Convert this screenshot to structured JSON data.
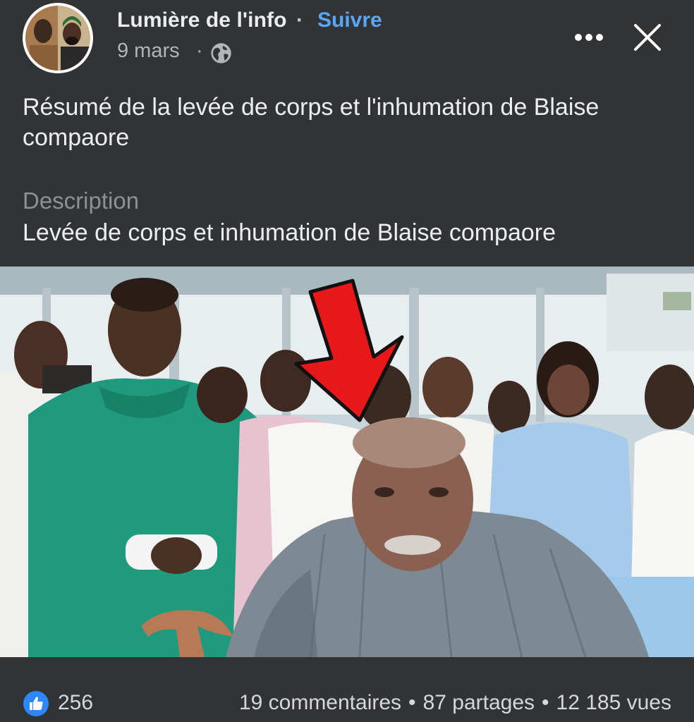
{
  "header": {
    "page_name": "Lumière de l'info",
    "separator": "·",
    "follow_label": "Suivre",
    "date": "9 mars",
    "date_separator": "·",
    "privacy_icon": "globe-icon",
    "more_icon": "more-options-icon",
    "close_icon": "close-icon"
  },
  "post": {
    "title": "Résumé de la levée de corps et l'inhumation de Blaise compaore",
    "description_label": "Description",
    "description_text": "Levée de corps et inhumation de Blaise compaore"
  },
  "video": {
    "thumbnail_icon": "red-arrow-icon"
  },
  "footer": {
    "reaction_icon": "like-icon",
    "like_count": "256",
    "comments": "19 commentaires",
    "shares": "87 partages",
    "views": "12 185 vues",
    "separator": "•"
  },
  "colors": {
    "background": "#323335",
    "accent": "#5aa7f8",
    "like_blue": "#2d88ff",
    "arrow_red": "#e8171a"
  }
}
